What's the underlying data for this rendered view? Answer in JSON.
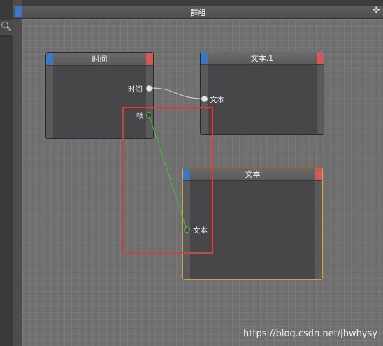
{
  "window": {
    "title": "群组"
  },
  "left_panel": {
    "search_icon": "search-icon"
  },
  "nodes": {
    "time": {
      "title": "时间",
      "output_time": "时间",
      "output_frame": "帧"
    },
    "text1": {
      "title": "文本.1",
      "input_text": "文本"
    },
    "text": {
      "title": "文本",
      "input_text": "文本"
    }
  },
  "colors": {
    "header_blue": "#3d76c1",
    "header_red": "#d05a5a",
    "selected_border": "#e0a030",
    "highlight_box": "#e03a3a",
    "green_wire": "#4caf3a"
  },
  "watermark": "https://blog.csdn.net/jbwhysy"
}
